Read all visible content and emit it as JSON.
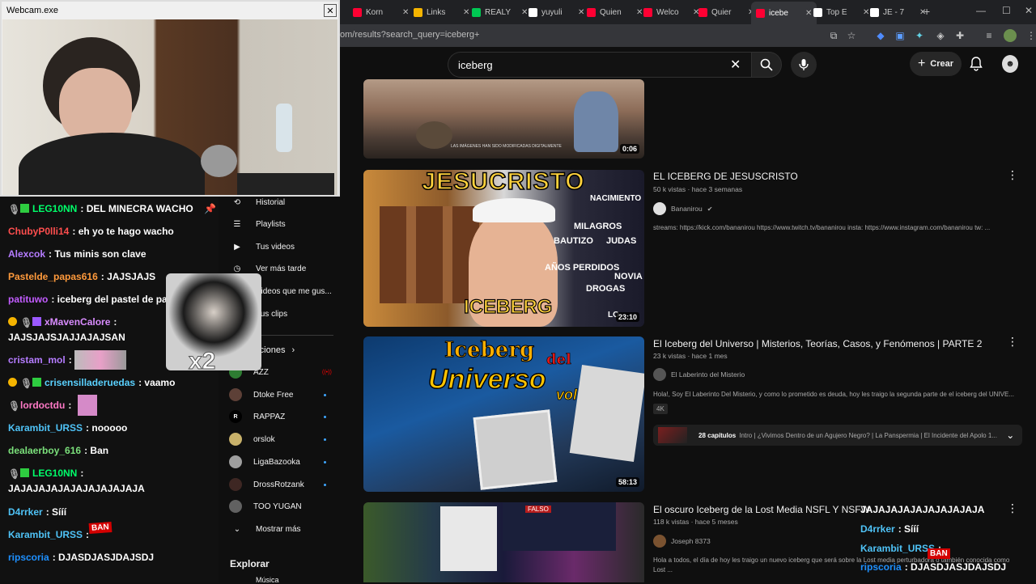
{
  "browser": {
    "tabs": [
      {
        "label": "Korn",
        "color": "#ff0033"
      },
      {
        "label": "Links",
        "color": "#f5b400"
      },
      {
        "label": "REALY",
        "color": "#00c853"
      },
      {
        "label": "yuyuli",
        "color": "#ffffff"
      },
      {
        "label": "Quien",
        "color": "#ff0033"
      },
      {
        "label": "Welco",
        "color": "#ff0033"
      },
      {
        "label": "Quier",
        "color": "#ff0033"
      },
      {
        "label": "icebe",
        "color": "#ff0033",
        "active": true
      },
      {
        "label": "Top E",
        "color": "#ffffff"
      },
      {
        "label": "JE - 7",
        "color": "#ffffff"
      }
    ],
    "url": "om/results?search_query=iceberg+"
  },
  "youtube": {
    "search_query": "iceberg",
    "create_label": "Crear"
  },
  "sidebar": {
    "items": [
      {
        "label": "Historial",
        "icon": "history-icon"
      },
      {
        "label": "Playlists",
        "icon": "playlist-icon"
      },
      {
        "label": "Tus videos",
        "icon": "video-icon"
      },
      {
        "label": "Ver más tarde",
        "icon": "clock-icon"
      },
      {
        "label": "Videos que me gus...",
        "icon": "like-icon"
      },
      {
        "label": "Tus clips",
        "icon": "scissors-icon"
      }
    ],
    "subs_label": "Suscripciones",
    "channels": [
      {
        "label": "AZZ",
        "color": "#2e7d32",
        "live": true
      },
      {
        "label": "Dtoke Free",
        "color": "#5d4037",
        "dot": true
      },
      {
        "label": "RAPPAZ",
        "color": "#000000",
        "dot": true
      },
      {
        "label": "orslok",
        "color": "#c8b16a",
        "dot": true
      },
      {
        "label": "LigaBazooka",
        "color": "#9e9e9e",
        "dot": true
      },
      {
        "label": "DrossRotzank",
        "color": "#3e2723",
        "dot": true
      },
      {
        "label": "TOO YUGAN",
        "color": "#616161"
      }
    ],
    "show_more": "Mostrar más",
    "explore": "Explorar",
    "more_item": "Música"
  },
  "results": [
    {
      "duration": "0:06",
      "caption": "LAS IMÁGENES HAN SIDO MODIFICADAS DIGITALMENTE"
    },
    {
      "title": "EL ICEBERG DE JESUSCRISTO",
      "meta": "50 k vistas · hace 3 semanas",
      "channel": "Bananirou",
      "desc": "streams: https://kick.com/bananirou https://www.twitch.tv/bananirou insta: https://www.instagram.com/bananirou tw: ...",
      "duration": "23:10",
      "thumb_big": "JESUCRISTO",
      "thumb_sub": "ICEBERG",
      "thumb_tags": [
        "NACIMIENTO",
        "MILAGROS",
        "BAUTIZO",
        "JUDAS",
        "AÑOS PERDIDOS",
        "NOVIA",
        "DROGAS",
        "LO"
      ]
    },
    {
      "title": "El Iceberg del Universo | Misterios, Teorías, Casos, y Fenómenos | PARTE 2",
      "meta": "23 k vistas · hace 1 mes",
      "channel": "El Laberinto del Misterio",
      "desc": "Hola!, Soy El Laberinto Del Misterio, y como lo prometido es deuda, hoy les traigo la segunda parte de el iceberg del UNIVE...",
      "badge": "4K",
      "chapters_count": "28 capítulos",
      "chapters_text": "Intro | ¿Vivimos Dentro de un Agujero Negro? | La Panspermia | El Incidente del Apolo 1...",
      "duration": "58:13",
      "thumb_t1": "Iceberg",
      "thumb_t2": "del",
      "thumb_t3": "Universo",
      "thumb_t4": "vol.2"
    },
    {
      "title": "El oscuro Iceberg de la Lost Media NSFL Y NSFW",
      "meta": "118 k vistas · hace 5 meses",
      "channel": "Joseph 8373",
      "desc": "Hola a todos, el día de hoy les traigo un nuevo iceberg que será sobre la Lost media perturbadora o también conocida como Lost ...",
      "thumb_label": "FALSO"
    }
  ],
  "webcam": {
    "title": "Webcam.exe"
  },
  "chat": [
    {
      "user": "LEG10NN",
      "color": "#00ff6a",
      "text": "DEL MINECRA WACHO",
      "badges": true
    },
    {
      "user": "ChubyP0lli14",
      "color": "#ff4e4e",
      "text": "eh yo te hago wacho"
    },
    {
      "user": "Alexcok",
      "color": "#b57cff",
      "text": "Tus minis son clave"
    },
    {
      "user": "Pastelde_papas616",
      "color": "#ff9a3c",
      "text": "JAJSJAJS"
    },
    {
      "user": "patituwo",
      "color": "#c25cff",
      "text": "iceberg del pastel de pa"
    },
    {
      "user": "xMavenCalore",
      "color": "#d98cff",
      "text": "",
      "badges": true
    },
    {
      "user": "",
      "color": "#ffffff",
      "text": "JAJSJAJSJAJJAJAJSAN"
    },
    {
      "user": "cristam_mol",
      "color": "#b57cff",
      "text": ""
    },
    {
      "user": "crisensilladeruedas",
      "color": "#5ad1ff",
      "text": "vaamo",
      "badges": true
    },
    {
      "user": "lordoctdu",
      "color": "#ff79c6",
      "text": ""
    },
    {
      "user": "Karambit_URSS",
      "color": "#4fc3f7",
      "text": "nooooo"
    },
    {
      "user": "dealaerboy_616",
      "color": "#7be07b",
      "text": "Ban"
    },
    {
      "user": "LEG10NN",
      "color": "#00ff6a",
      "text": "",
      "badges": true
    },
    {
      "user": "",
      "color": "#ffffff",
      "text": "JAJAJAJAJAJAJAJAJAJAJA"
    },
    {
      "user": "D4rrker",
      "color": "#4fc3f7",
      "text": "Sííí"
    },
    {
      "user": "Karambit_URSS",
      "color": "#4fc3f7",
      "text": ""
    },
    {
      "user": "ripscoria",
      "color": "#1e90ff",
      "text": "DJASDJASJDAJSDJ"
    }
  ],
  "overlay_emote": {
    "text": "x2"
  },
  "chat2": [
    {
      "user": "",
      "color": "#ffffff",
      "text": "JAJAJAJAJAJAJAJAJAJA"
    },
    {
      "user": "D4rrker",
      "color": "#4fc3f7",
      "text": "Sííí"
    },
    {
      "user": "Karambit_URSS",
      "color": "#4fc3f7",
      "text": ""
    },
    {
      "user": "ripscoria",
      "color": "#1e90ff",
      "text": "DJASDJASJDAJSDJ"
    }
  ],
  "ban_label": "BAN",
  "colors": {
    "yt_red": "#ff0000",
    "bg": "#0f0f0f",
    "chat_bg": "#121212"
  }
}
